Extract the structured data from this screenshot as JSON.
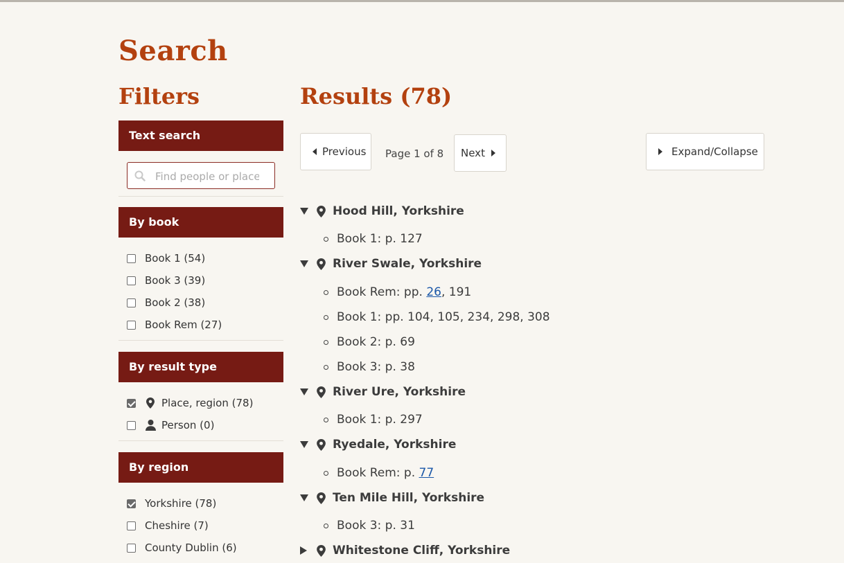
{
  "header": {
    "title": "Search"
  },
  "filters": {
    "title": "Filters",
    "text_search": {
      "heading": "Text search",
      "placeholder": "Find people or places"
    },
    "by_book": {
      "heading": "By book",
      "items": [
        {
          "label": "Book 1 (54)",
          "checked": false
        },
        {
          "label": "Book 3 (39)",
          "checked": false
        },
        {
          "label": "Book 2 (38)",
          "checked": false
        },
        {
          "label": "Book Rem (27)",
          "checked": false
        }
      ]
    },
    "by_result_type": {
      "heading": "By result type",
      "items": [
        {
          "label": "Place, region (78)",
          "checked": true,
          "icon": "map-marker-icon"
        },
        {
          "label": "Person (0)",
          "checked": false,
          "icon": "person-icon"
        }
      ]
    },
    "by_region": {
      "heading": "By region",
      "items": [
        {
          "label": "Yorkshire (78)",
          "checked": true
        },
        {
          "label": "Cheshire (7)",
          "checked": false
        },
        {
          "label": "County Dublin (6)",
          "checked": false
        }
      ]
    }
  },
  "results": {
    "title": "Results (78)",
    "pagination": {
      "previous": "Previous",
      "info": "Page 1 of 8",
      "next": "Next"
    },
    "expand_collapse": "Expand/Collapse",
    "places": [
      {
        "name": "Hood Hill, Yorkshire",
        "expanded": true,
        "books": [
          {
            "prefix": "Book 1: p. 127",
            "links": [],
            "suffix": ""
          }
        ]
      },
      {
        "name": "River Swale, Yorkshire",
        "expanded": true,
        "books": [
          {
            "prefix": "Book Rem: pp. ",
            "links": [
              "26"
            ],
            "suffix": ", 191"
          },
          {
            "prefix": "Book 1: pp. 104, 105, 234, 298, 308",
            "links": [],
            "suffix": ""
          },
          {
            "prefix": "Book 2: p. 69",
            "links": [],
            "suffix": ""
          },
          {
            "prefix": "Book 3: p. 38",
            "links": [],
            "suffix": ""
          }
        ]
      },
      {
        "name": "River Ure, Yorkshire",
        "expanded": true,
        "books": [
          {
            "prefix": "Book 1: p. 297",
            "links": [],
            "suffix": ""
          }
        ]
      },
      {
        "name": "Ryedale, Yorkshire",
        "expanded": true,
        "books": [
          {
            "prefix": "Book Rem: p. ",
            "links": [
              "77"
            ],
            "suffix": ""
          }
        ]
      },
      {
        "name": "Ten Mile Hill, Yorkshire",
        "expanded": true,
        "books": [
          {
            "prefix": "Book 3: p. 31",
            "links": [],
            "suffix": ""
          }
        ]
      },
      {
        "name": "Whitestone Cliff, Yorkshire",
        "expanded": false,
        "books": []
      }
    ]
  },
  "colors": {
    "accent": "#b3410f",
    "panel_header": "#761b14",
    "link": "#1a57a8",
    "background": "#f8f6f1"
  }
}
